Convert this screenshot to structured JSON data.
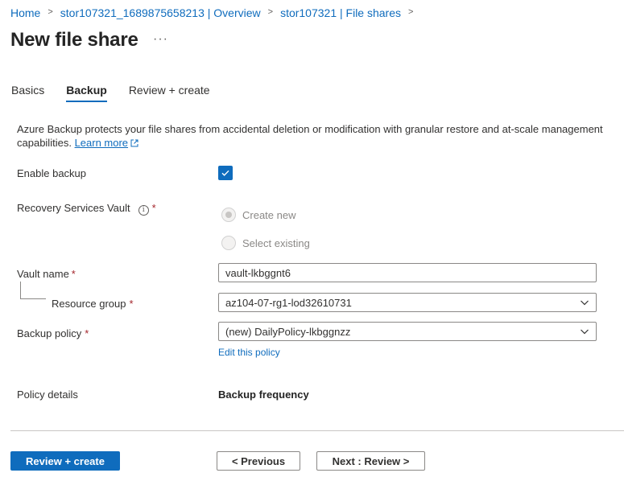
{
  "breadcrumb": [
    {
      "label": "Home"
    },
    {
      "label": "stor107321_1689875658213 | Overview"
    },
    {
      "label": "stor107321 | File shares"
    }
  ],
  "page": {
    "title": "New file share",
    "more": "···"
  },
  "tabs": [
    {
      "label": "Basics"
    },
    {
      "label": "Backup",
      "active": true
    },
    {
      "label": "Review + create"
    }
  ],
  "description": {
    "text": "Azure Backup protects your file shares from accidental deletion or modification with granular restore and at-scale management capabilities.",
    "link": "Learn more"
  },
  "form": {
    "enable_backup": {
      "label": "Enable backup",
      "checked": true
    },
    "vault": {
      "label": "Recovery Services Vault",
      "required": "*",
      "info": "i",
      "options": [
        {
          "label": "Create new",
          "selected": true
        },
        {
          "label": "Select existing",
          "selected": false
        }
      ]
    },
    "vault_name": {
      "label": "Vault name",
      "required": "*",
      "value": "vault-lkbggnt6"
    },
    "resource_group": {
      "label": "Resource group",
      "required": "*",
      "value": "az104-07-rg1-lod32610731"
    },
    "backup_policy": {
      "label": "Backup policy",
      "required": "*",
      "value": "(new) DailyPolicy-lkbggnzz",
      "edit_link": "Edit this policy"
    },
    "policy_details": {
      "label": "Policy details",
      "value_label": "Backup frequency"
    }
  },
  "footer": {
    "primary": "Review + create",
    "previous": "< Previous",
    "next": "Next : Review >"
  },
  "colors": {
    "accent": "#0f6cbd",
    "required": "#a4262c"
  }
}
